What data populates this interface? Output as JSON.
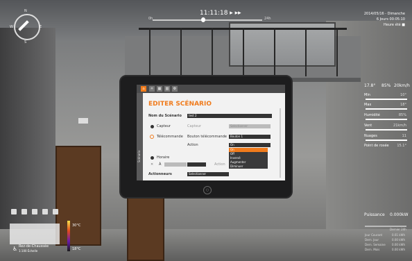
{
  "hud": {
    "time": "11:11:18 ▸ ▸▸",
    "slider_min": "0h",
    "slider_max": "24h",
    "compass": {
      "n": "N",
      "e": "E",
      "s": "S",
      "w": "W"
    },
    "date_line1": "2014/05/16 - Dimanche",
    "date_line2": "6 Jours 00:05:10",
    "date_line3": "Heure été ■"
  },
  "weather": {
    "temp": "17.8°",
    "humidity": "85%",
    "wind": "20km/h",
    "rows": [
      {
        "label": "Min",
        "value": "10°"
      },
      {
        "label": "Max",
        "value": "18°"
      },
      {
        "label": "Humidité",
        "value": "85%"
      },
      {
        "label": "Vent",
        "value": "21km/h"
      },
      {
        "label": "Nuages",
        "value": "11"
      },
      {
        "label": "Point de rosée",
        "value": "15.1°"
      }
    ]
  },
  "tablet": {
    "title": "EDITER SCÉNARIO",
    "name_label": "Nom du Scénario",
    "name_value": "test 2",
    "capteur_label": "Capteur",
    "capteur_sub": "Capteur",
    "capteur_select": "Selectionner",
    "tele_label": "Télécommande",
    "tele_sub": "Bouton télécommande",
    "tele_select": "Bouton 1",
    "action_label": "Action",
    "action_select": "On",
    "menu_items": [
      "On",
      "Off",
      "Inversé",
      "Augmenter",
      "Diminuer"
    ],
    "horaire_label": "Horaire",
    "a_label": "À",
    "action2_label": "Action",
    "actionneurs_label": "Actionneurs",
    "actionneurs_select": "Selectionner",
    "side_label": "Scénario"
  },
  "bottom_left": {
    "temp_high": "30°C",
    "temp_low": "18°C",
    "level": "Rez-de-Chaussée",
    "scale": "1:100 Échelle"
  },
  "power": {
    "label": "Puissance",
    "value": "0.000kW",
    "header": "Dernier 24h",
    "rows": [
      {
        "label": "Jour Courant",
        "value": "0.01 kWh"
      },
      {
        "label": "Dern. Jour",
        "value": "0.00 kWh"
      },
      {
        "label": "Dern. Semaine",
        "value": "0.00 kWh"
      },
      {
        "label": "Dern. Mois",
        "value": "0.00 kWh"
      }
    ]
  }
}
